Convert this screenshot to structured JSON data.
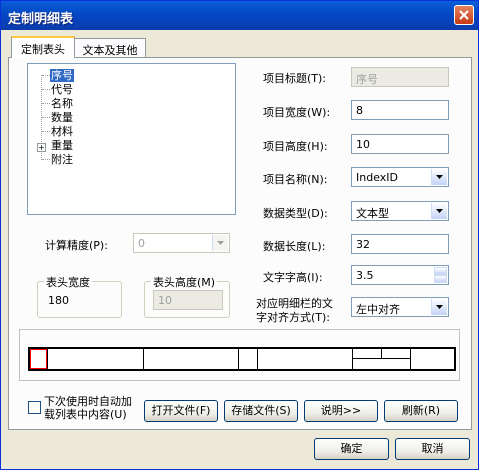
{
  "window": {
    "title": "定制明细表"
  },
  "tabs": [
    {
      "label": "定制表头",
      "active": true
    },
    {
      "label": "文本及其他",
      "active": false
    }
  ],
  "tree": {
    "items": [
      {
        "label": "序号",
        "selected": true
      },
      {
        "label": "代号"
      },
      {
        "label": "名称"
      },
      {
        "label": "数量"
      },
      {
        "label": "材料"
      },
      {
        "label": "重量",
        "expandable": true
      },
      {
        "label": "附注"
      }
    ]
  },
  "form": {
    "item_title_label": "项目标题(T):",
    "item_title_value": "序号",
    "item_width_label": "项目宽度(W):",
    "item_width_value": "8",
    "item_height_label": "项目高度(H):",
    "item_height_value": "10",
    "item_name_label": "项目名称(N):",
    "item_name_value": "IndexID",
    "data_type_label": "数据类型(D):",
    "data_type_value": "文本型",
    "data_length_label": "数据长度(L):",
    "data_length_value": "32",
    "font_height_label": "文字字高(I):",
    "font_height_value": "3.5",
    "align_label_line1": "对应明细栏的文",
    "align_label_line2": "字对齐方式(T):",
    "align_value": "左中对齐"
  },
  "precision": {
    "label": "计算精度(P):",
    "value": "0"
  },
  "header_width": {
    "title": "表头宽度",
    "value": "180"
  },
  "header_height": {
    "title": "表头高度(M)",
    "value": "10"
  },
  "auto_load": {
    "line1": "下次使用时自动加",
    "line2": "载列表中内容(U)",
    "checked": false
  },
  "buttons": {
    "open_file": "打开文件(F)",
    "save_file": "存储文件(S)",
    "help": "说明>>",
    "refresh": "刷新(R)",
    "ok": "确定",
    "cancel": "取消"
  },
  "colors": {
    "titlebar": "#0447c4",
    "selection": "#316ac5",
    "preview_selected_cell": "#ff0000"
  }
}
